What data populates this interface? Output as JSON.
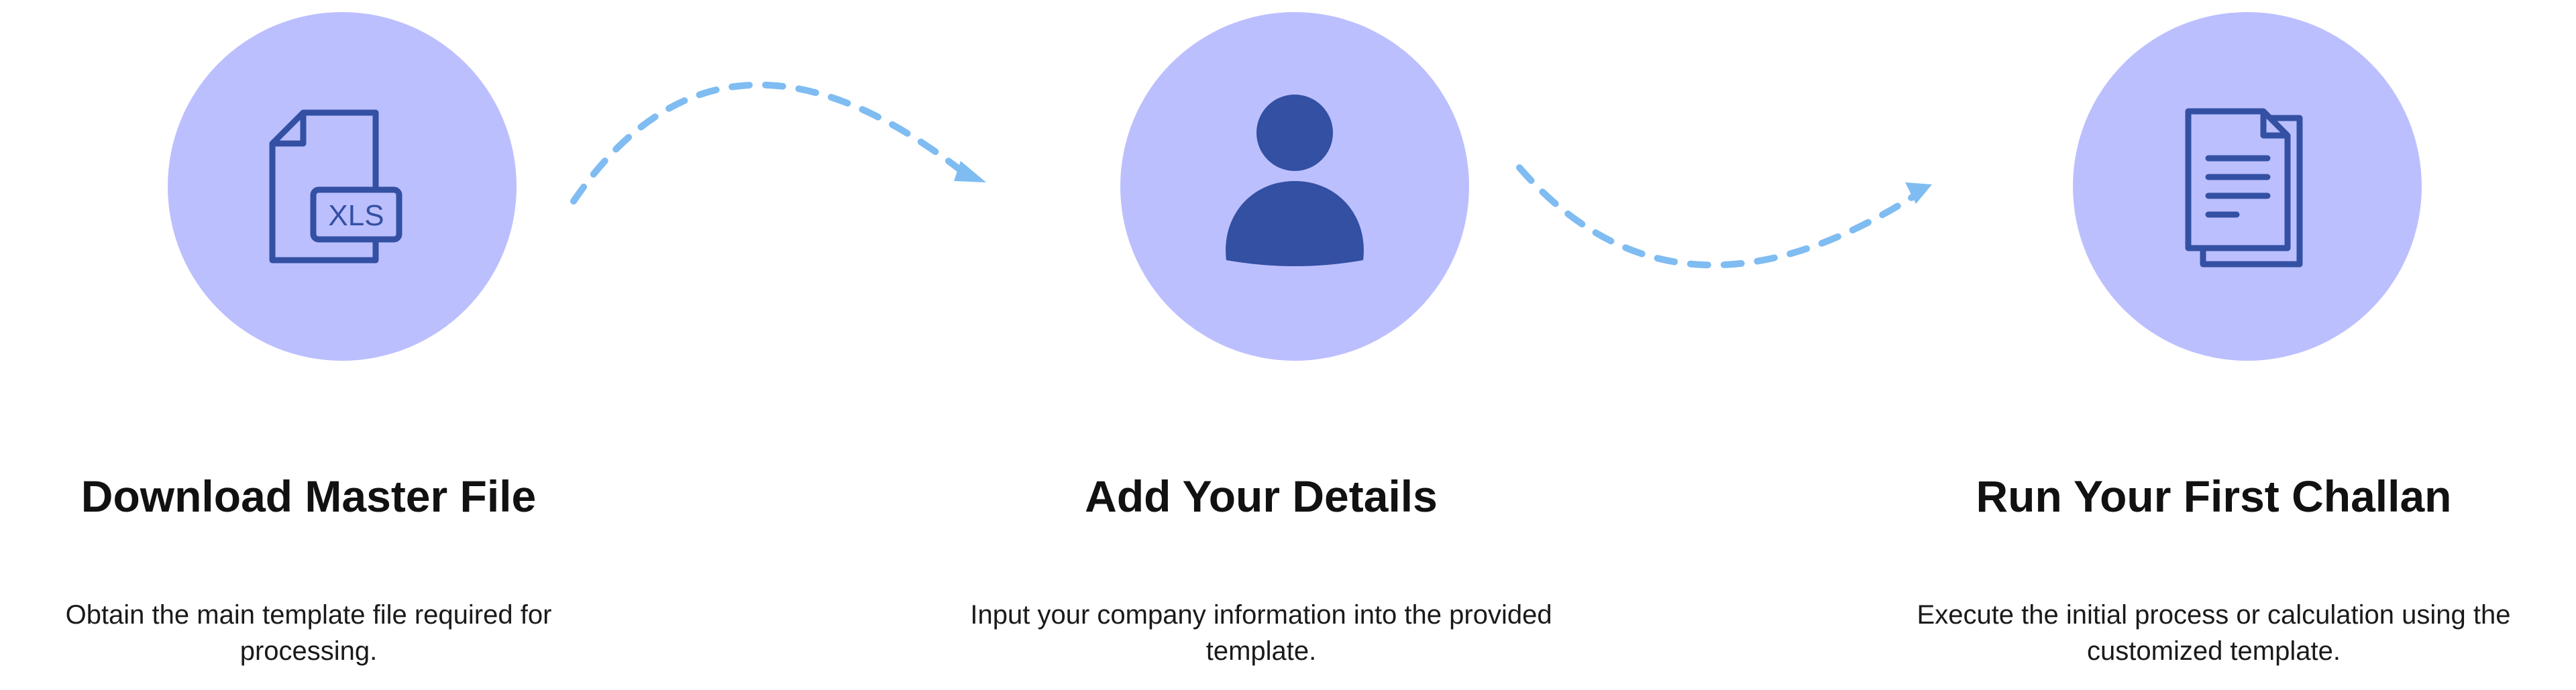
{
  "colors": {
    "circle_fill": "#bcbffe",
    "icon_stroke": "#3350a3",
    "icon_fill": "#3350a3",
    "arrow": "#7fbcf2"
  },
  "steps": [
    {
      "icon": "xls-file-icon",
      "icon_text": "XLS",
      "title": "Download Master File",
      "desc_line1": "Obtain the main template file required for",
      "desc_line2": "processing."
    },
    {
      "icon": "user-icon",
      "title": "Add Your Details",
      "desc_line1": "Input your company information into the provided",
      "desc_line2": "template."
    },
    {
      "icon": "documents-icon",
      "title": "Run Your First Challan",
      "desc_line1": "Execute the initial process or calculation using the",
      "desc_line2": "customized template."
    }
  ]
}
